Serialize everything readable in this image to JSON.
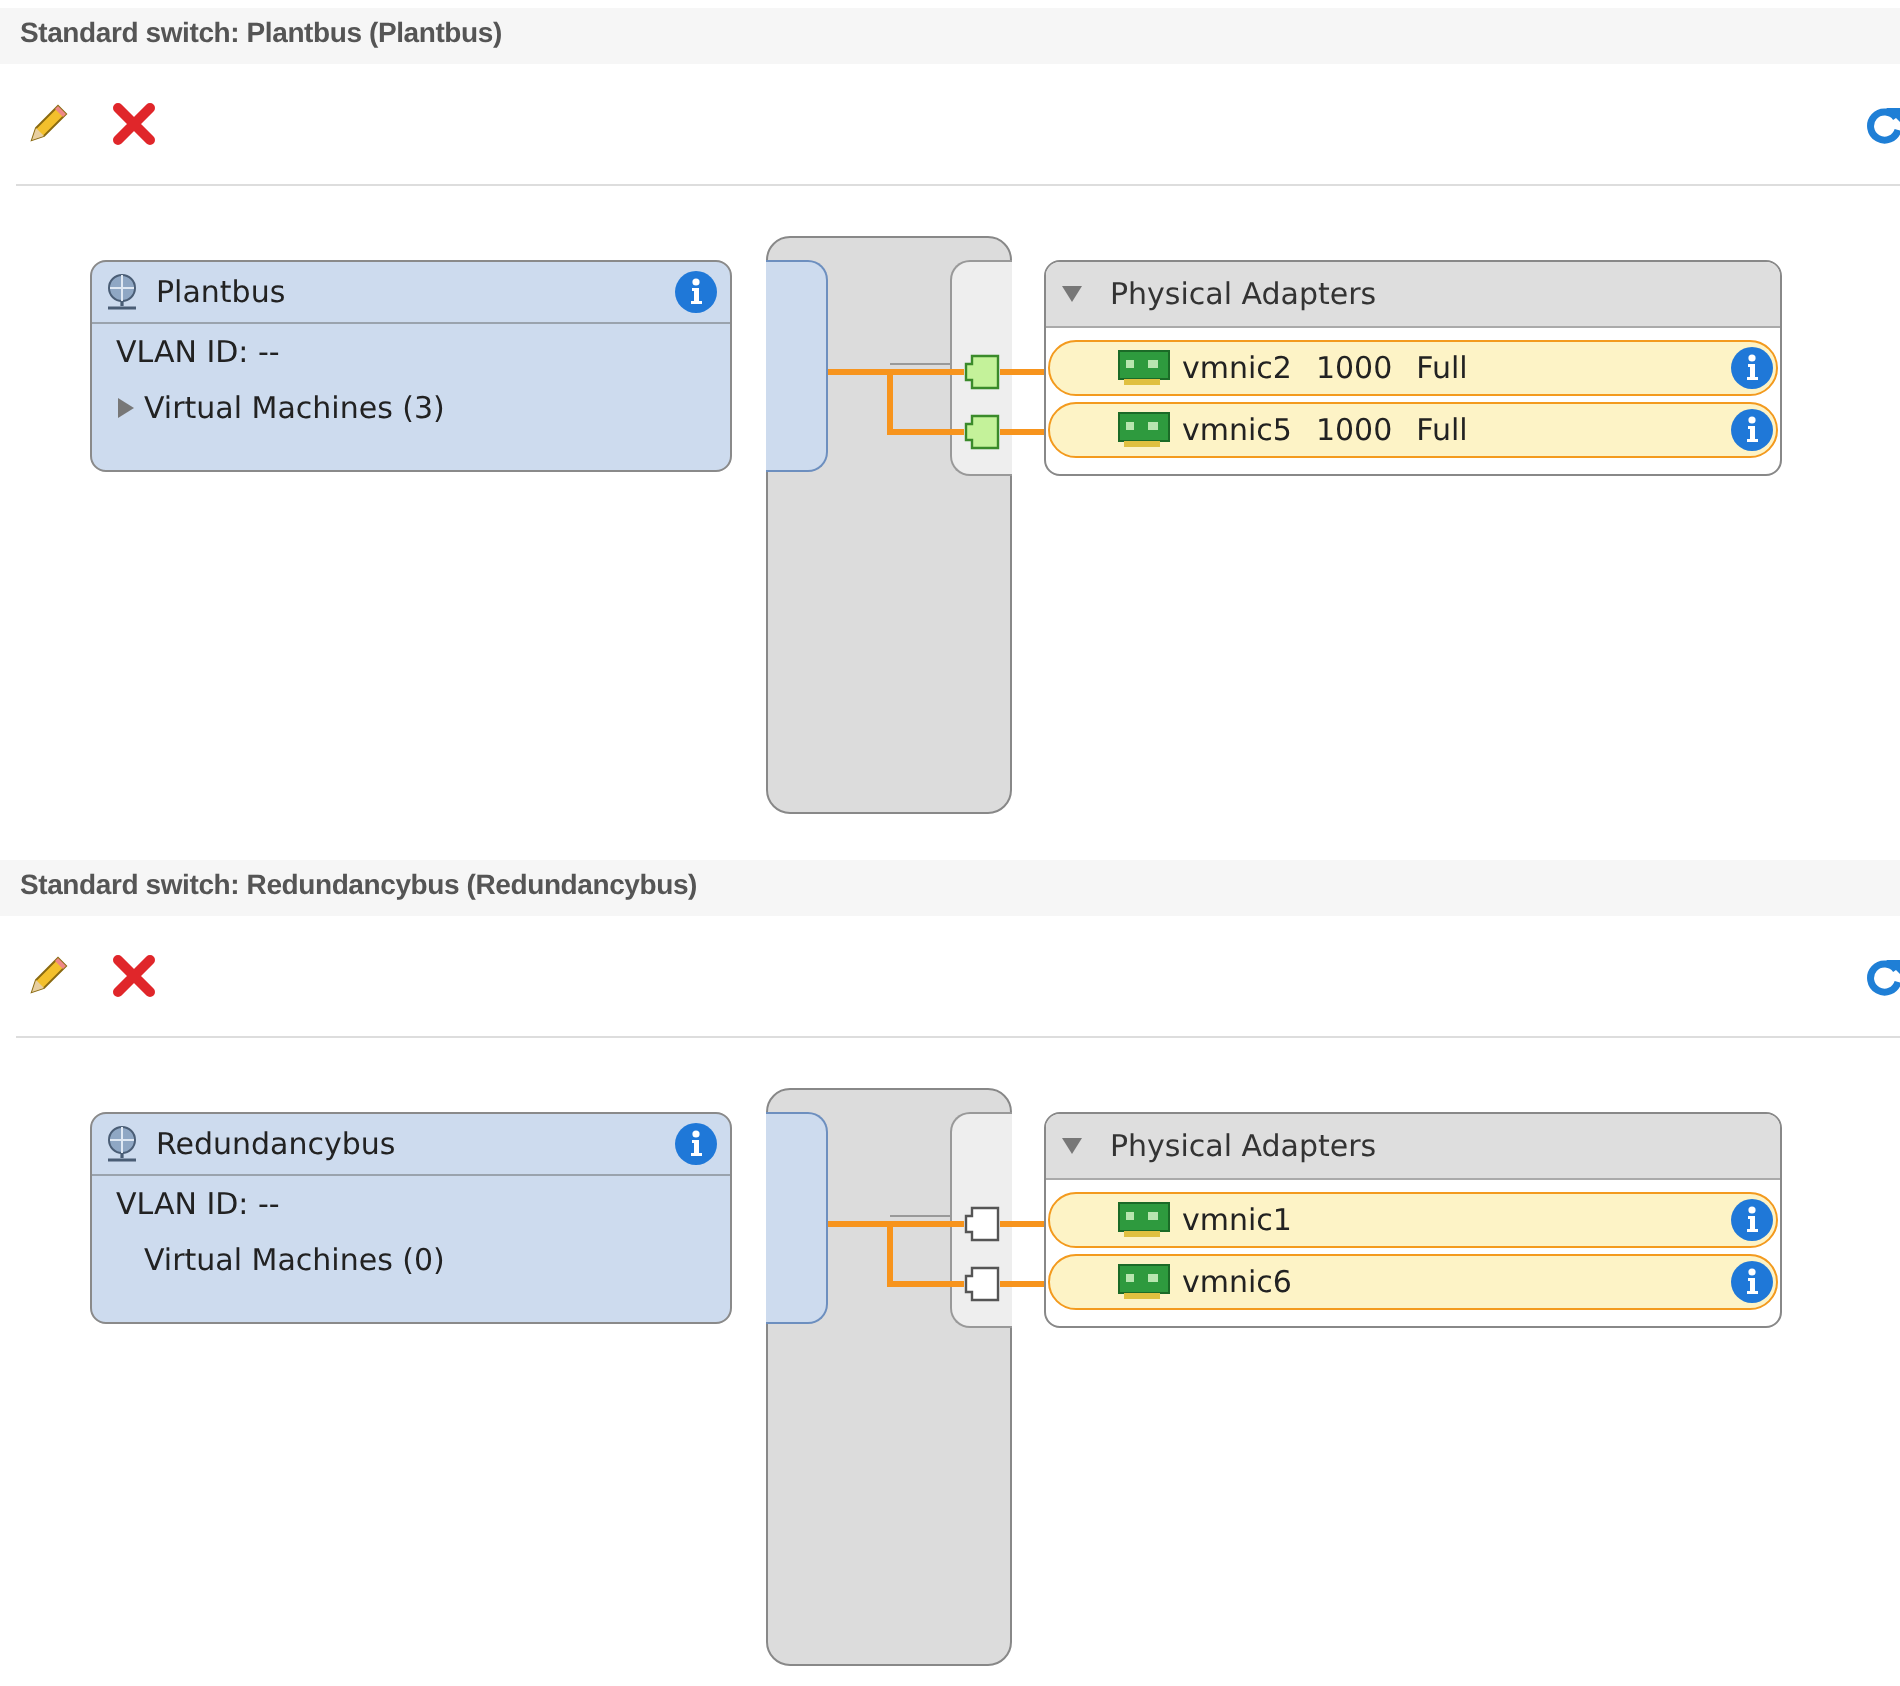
{
  "switches": [
    {
      "title": "Standard switch: Plantbus (Plantbus)",
      "portgroup": {
        "name": "Plantbus",
        "vlan": "VLAN ID: --",
        "vms": "Virtual Machines (3)",
        "vms_expandable": true
      },
      "adapters": {
        "header": "Physical Adapters",
        "expanded": true,
        "items": [
          {
            "name": "vmnic2",
            "speed": "1000",
            "duplex": "Full",
            "connected": true
          },
          {
            "name": "vmnic5",
            "speed": "1000",
            "duplex": "Full",
            "connected": true
          }
        ]
      }
    },
    {
      "title": "Standard switch: Redundancybus (Redundancybus)",
      "portgroup": {
        "name": "Redundancybus",
        "vlan": "VLAN ID: --",
        "vms": "Virtual Machines (0)",
        "vms_expandable": false
      },
      "adapters": {
        "header": "Physical Adapters",
        "expanded": true,
        "items": [
          {
            "name": "vmnic1",
            "connected": false
          },
          {
            "name": "vmnic6",
            "connected": false
          }
        ]
      }
    }
  ]
}
